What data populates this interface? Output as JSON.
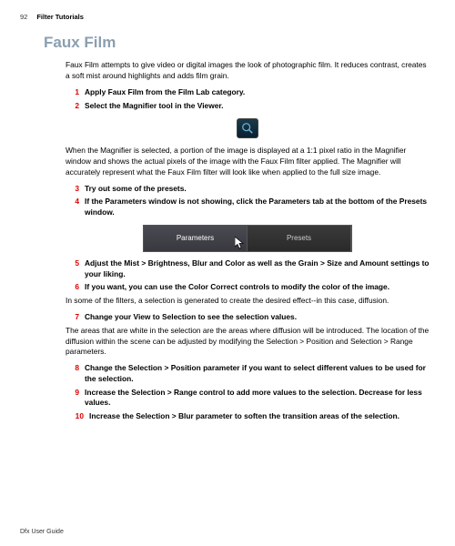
{
  "page_number": "92",
  "chapter": "Filter Tutorials",
  "title": "Faux Film",
  "intro": "Faux Film attempts to give video or digital images the look of photographic film. It reduces contrast, creates a soft mist around highlights and adds film grain.",
  "steps": {
    "s1": "Apply Faux Film from the Film Lab category.",
    "s2": "Select the Magnifier tool in the Viewer.",
    "s3": "Try out some of the presets.",
    "s4": "If the Parameters window is not showing, click the Parameters tab at the bottom of the Presets window.",
    "s5": "Adjust the Mist > Brightness, Blur and Color as well as the Grain > Size and Amount settings to your liking.",
    "s6": "If you want, you can use the Color Correct controls to modify the color of the image.",
    "s7": "Change your View to Selection to see the selection values.",
    "s8": "Change the Selection > Position parameter if you want to select different values to be used for the selection.",
    "s9": "Increase the Selection > Range control to add more values to the selection. Decrease for less values.",
    "s10": "Increase the Selection > Blur parameter to soften the transition areas of the selection."
  },
  "after2": "When the Magnifier is selected, a portion of the image is displayed at a 1:1 pixel ratio in the Magnifier window and shows the actual pixels of the image with the Faux Film filter applied. The Magnifier will accurately represent what the Faux Film filter will look like when applied to the full size image.",
  "after6": "In some of the filters, a selection is generated to create the desired effect--in this case, diffusion.",
  "after7": "The areas that are white in the selection are the areas where diffusion will be introduced. The location of the diffusion within the scene can be adjusted by modifying the Selection > Position and Selection > Range parameters.",
  "tabs": {
    "parameters": "Parameters",
    "presets": "Presets"
  },
  "footer": "Dfx User Guide"
}
